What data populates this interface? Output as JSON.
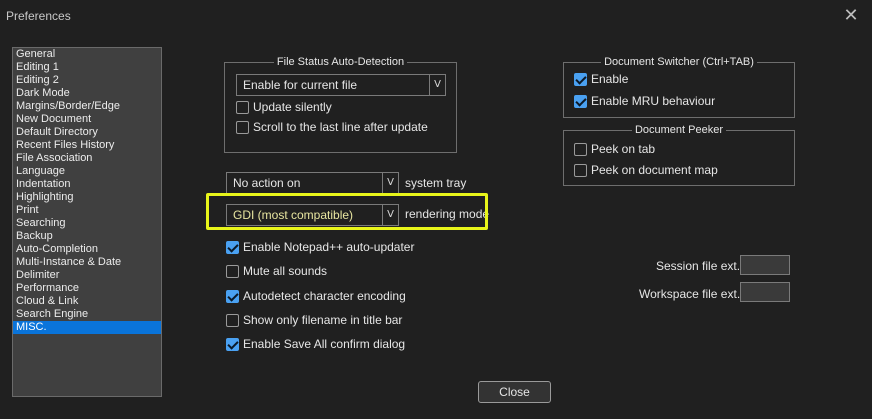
{
  "window": {
    "title": "Preferences"
  },
  "sidebar": {
    "items": [
      "General",
      "Editing 1",
      "Editing 2",
      "Dark Mode",
      "Margins/Border/Edge",
      "New Document",
      "Default Directory",
      "Recent Files History",
      "File Association",
      "Language",
      "Indentation",
      "Highlighting",
      "Print",
      "Searching",
      "Backup",
      "Auto-Completion",
      "Multi-Instance & Date",
      "Delimiter",
      "Performance",
      "Cloud & Link",
      "Search Engine",
      "MISC."
    ],
    "selected": "MISC."
  },
  "file_status": {
    "title": "File Status Auto-Detection",
    "combo_value": "Enable for current file",
    "update_silently": "Update silently",
    "scroll_last_line": "Scroll to the last line after update"
  },
  "tray": {
    "combo_value": "No action on",
    "label": "system tray"
  },
  "rendering": {
    "combo_value": "GDI (most compatible)",
    "label": "rendering mode"
  },
  "options": {
    "auto_updater": "Enable Notepad++ auto-updater",
    "mute_sounds": "Mute all sounds",
    "autodetect_encoding": "Autodetect character encoding",
    "filename_title": "Show only filename in title bar",
    "save_all_confirm": "Enable Save All confirm dialog"
  },
  "doc_switcher": {
    "title": "Document Switcher (Ctrl+TAB)",
    "enable": "Enable",
    "mru": "Enable MRU behaviour"
  },
  "doc_peeker": {
    "title": "Document Peeker",
    "peek_tab": "Peek on tab",
    "peek_map": "Peek on document map"
  },
  "session": {
    "label": "Session file ext.:"
  },
  "workspace": {
    "label": "Workspace file ext.:"
  },
  "buttons": {
    "close": "Close"
  },
  "icons": {
    "close": "close-icon",
    "dropdown": "chevron-down-icon",
    "checkmark": "checkmark-icon"
  },
  "colors": {
    "accent": "#4aa1f2",
    "selection": "#0a74da",
    "highlight": "#e8f51a"
  }
}
